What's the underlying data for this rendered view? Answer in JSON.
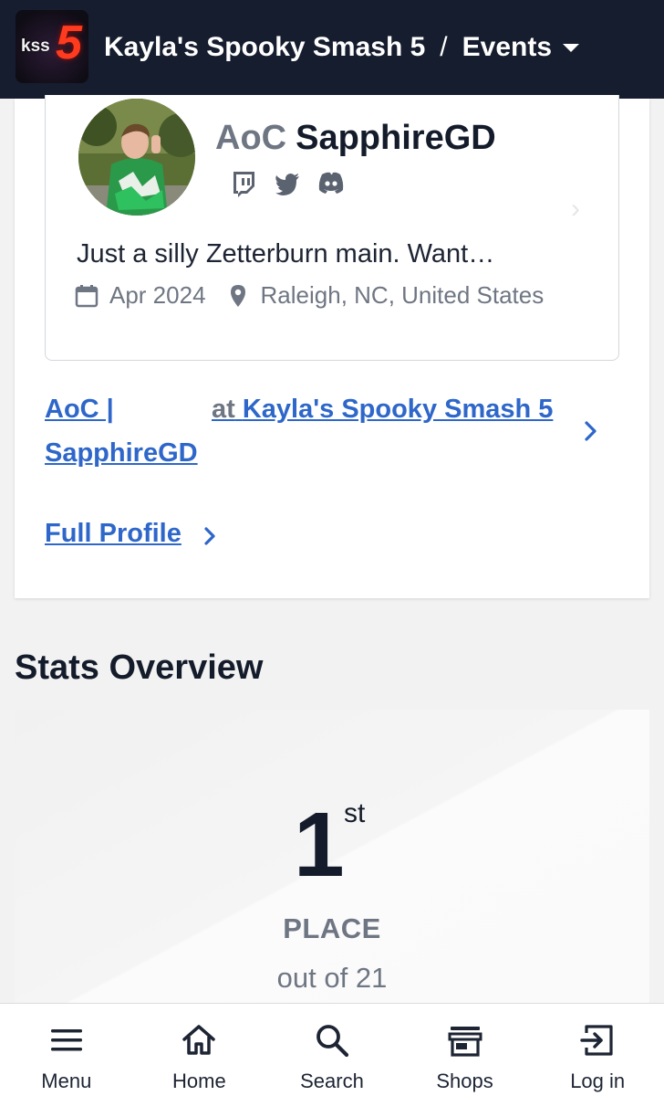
{
  "header": {
    "logo_text": "kss",
    "logo_number": "5",
    "title": "Kayla's Spooky Smash 5",
    "separator": "/",
    "section": "Events"
  },
  "profile": {
    "prefix": "AoC",
    "gamertag": "SapphireGD",
    "socials": [
      "twitch-icon",
      "twitter-icon",
      "discord-icon"
    ],
    "bio": "Just a silly Zetterburn main. Want…",
    "joined": "Apr 2024",
    "location": "Raleigh, NC, United States"
  },
  "links": {
    "entrant_line1": "AoC |",
    "entrant_line2": "SapphireGD",
    "at_word": "at",
    "event_name": "Kayla's Spooky Smash 5",
    "full_profile": "Full Profile"
  },
  "stats": {
    "section_title": "Stats Overview",
    "place_number": "1",
    "place_suffix": "st",
    "place_label": "PLACE",
    "out_of": "out of 21"
  },
  "nav": {
    "items": [
      {
        "label": "Menu",
        "icon": "menu-icon"
      },
      {
        "label": "Home",
        "icon": "home-icon"
      },
      {
        "label": "Search",
        "icon": "search-icon"
      },
      {
        "label": "Shops",
        "icon": "shop-icon"
      },
      {
        "label": "Log in",
        "icon": "login-icon"
      }
    ]
  },
  "colors": {
    "header_bg": "#161d2e",
    "link": "#2e67c9",
    "muted": "#6f7683"
  }
}
